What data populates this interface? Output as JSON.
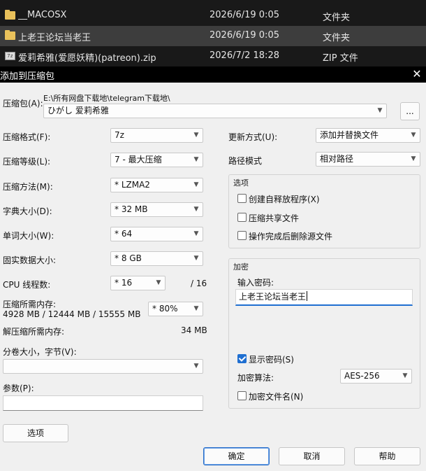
{
  "files": [
    {
      "name": "__MACOSX",
      "date": "2026/6/19 0:05",
      "type": "文件夹",
      "icon": "folder-icon"
    },
    {
      "name": "上老王论坛当老王",
      "date": "2026/6/19 0:05",
      "type": "文件夹",
      "icon": "folder-icon"
    },
    {
      "name": "爱莉希雅(爱愿妖精)(patreon).zip",
      "date": "2026/7/2 18:28",
      "type": "ZIP 文件",
      "icon": "zip-file-icon"
    }
  ],
  "dialog": {
    "title": "添加到压缩包",
    "archive_label": "压缩包(A):",
    "archive_path": "E:\\所有网盘下载地\\telegram下载地\\",
    "archive_name": "ひがし 爱莉希雅",
    "browse_label": "...",
    "format_label": "压缩格式(F):",
    "format_value": "7z",
    "level_label": "压缩等级(L):",
    "level_value": "7 - 最大压缩",
    "method_label": "压缩方法(M):",
    "method_value": "* LZMA2",
    "dict_label": "字典大小(D):",
    "dict_value": "* 32 MB",
    "word_label": "单词大小(W):",
    "word_value": "* 64",
    "solid_label": "固实数据大小:",
    "solid_value": "* 8 GB",
    "cpu_label": "CPU 线程数:",
    "cpu_value": "* 16",
    "cpu_total": "/ 16",
    "mem_label": "压缩所需内存:",
    "mem_info": "4928 MB / 12444 MB / 15555 MB",
    "mem_value": "* 80%",
    "decomp_label": "解压缩所需内存:",
    "decomp_value": "34 MB",
    "split_label": "分卷大小，字节(V):",
    "split_value": "",
    "params_label": "参数(P):",
    "params_value": "",
    "options_button": "选项",
    "update_label": "更新方式(U):",
    "update_value": "添加并替换文件",
    "path_label": "路径模式",
    "path_value": "相对路径",
    "options_group": "选项",
    "opt_sfx": "创建自释放程序(X)",
    "opt_shared": "压缩共享文件",
    "opt_delete": "操作完成后删除源文件",
    "enc_group": "加密",
    "pw_label": "输入密码:",
    "pw_value": "上老王论坛当老王",
    "show_pw": "显示密码(S)",
    "enc_method_label": "加密算法:",
    "enc_method_value": "AES-256",
    "enc_names": "加密文件名(N)",
    "ok": "确定",
    "cancel": "取消",
    "help": "帮助"
  },
  "colors": {
    "accent": "#1f6fd1",
    "dark_bg": "#191919",
    "dialog_bg": "#f0f0f0"
  }
}
